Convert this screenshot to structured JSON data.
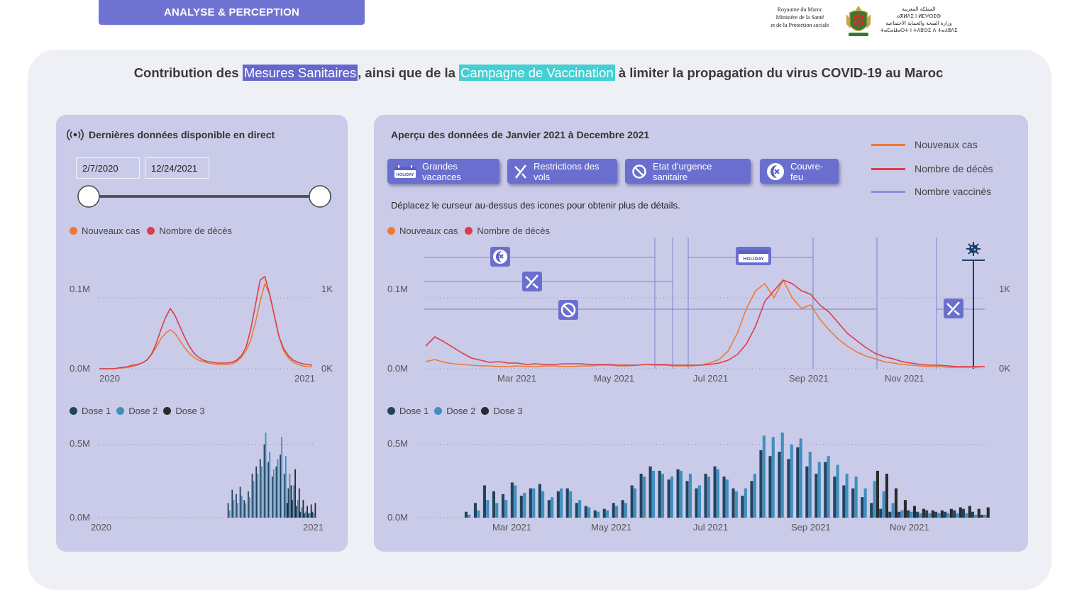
{
  "header": {
    "tab_label": "ANALYSE & PERCEPTION",
    "ministry_fr": [
      "Royaume du Maroc",
      "Ministère de la Santé",
      "et de la Protection sociale"
    ],
    "ministry_ar": [
      "المملكة المغربية",
      "ⴰⴳⵍⴷⵉ ⵏ ⵍⵎⵖⵔⵉⴱ",
      "وزارة الصحة والحماية الاجتماعية",
      "ⵜⴰⵎⴰⵡⴰⵙⵜ ⵏ ⵜⴷⵓⵙⵉ ⴷ ⵜⴰⵃⵓⴷⵉ"
    ],
    "emblem_icon": "coat-of-arms-icon"
  },
  "headline": {
    "before": "Contribution des ",
    "highlight1": "Mesures Sanitaires",
    "middle": ", ainsi que de la ",
    "highlight2": "Campagne de Vaccination",
    "after": " à limiter la propagation du virus COVID-19 au Maroc"
  },
  "left_panel": {
    "title": "Dernières données disponible en direct",
    "live_icon": "broadcast-icon",
    "date_start": "2/7/2020",
    "date_end": "12/24/2021",
    "slider_start": 0,
    "slider_end": 1
  },
  "right_panel": {
    "title": "Aperçu des données de Janvier 2021 à Decembre 2021",
    "buttons": [
      {
        "label": "Grandes vacances",
        "icon": "holiday-icon"
      },
      {
        "label": "Restrictions des vols",
        "icon": "plane-off-icon"
      },
      {
        "label": "Etat d'urgence sanitaire",
        "icon": "prohibited-icon"
      },
      {
        "label": "Couvre-feu",
        "icon": "curfew-icon"
      }
    ],
    "hint": "Déplacez le curseur au-dessus des icones pour obtenir plus de détails.",
    "legend": [
      {
        "label": "Nouveaux cas",
        "color": "#ee7a30"
      },
      {
        "label": "Nombre de décès",
        "color": "#dd3c4a"
      },
      {
        "label": "Nombre vaccinés",
        "color": "#8a8fd8"
      }
    ]
  },
  "colors": {
    "accent": "#6f74d3",
    "cases": "#ee7a30",
    "deaths": "#dd3c4a",
    "dose1": "#20445f",
    "dose2": "#3f8fbf",
    "dose3": "#2b2b2b"
  },
  "chart_data": [
    {
      "id": "left-cases",
      "type": "line",
      "legend": [
        "Nouveaux cas",
        "Nombre de décès"
      ],
      "x_ticks": [
        "2020",
        "2021"
      ],
      "y_left_ticks": [
        "0.0M",
        "0.1M"
      ],
      "y_right_ticks": [
        "0K",
        "1K"
      ],
      "ylim_left": [
        0,
        0.15
      ],
      "ylim_right": [
        0,
        1.5
      ],
      "series": [
        {
          "name": "Nouveaux cas",
          "axis": "left",
          "values": [
            0,
            0,
            0,
            0,
            0.001,
            0.001,
            0.002,
            0.003,
            0.005,
            0.008,
            0.012,
            0.02,
            0.03,
            0.042,
            0.05,
            0.055,
            0.05,
            0.04,
            0.03,
            0.022,
            0.016,
            0.012,
            0.01,
            0.008,
            0.007,
            0.006,
            0.006,
            0.006,
            0.007,
            0.01,
            0.016,
            0.025,
            0.04,
            0.065,
            0.095,
            0.12,
            0.105,
            0.075,
            0.045,
            0.025,
            0.015,
            0.009,
            0.006,
            0.004,
            0.003,
            0.003
          ]
        },
        {
          "name": "Nombre de décès",
          "axis": "right",
          "values": [
            0,
            0,
            0,
            0,
            0.01,
            0.02,
            0.03,
            0.05,
            0.06,
            0.08,
            0.12,
            0.2,
            0.35,
            0.55,
            0.72,
            0.85,
            0.75,
            0.6,
            0.45,
            0.32,
            0.22,
            0.16,
            0.12,
            0.1,
            0.09,
            0.08,
            0.08,
            0.08,
            0.09,
            0.12,
            0.18,
            0.3,
            0.55,
            0.9,
            1.25,
            1.3,
            1.05,
            0.75,
            0.45,
            0.28,
            0.18,
            0.12,
            0.09,
            0.07,
            0.06,
            0.05
          ]
        }
      ]
    },
    {
      "id": "left-doses",
      "type": "bar",
      "legend": [
        "Dose 1",
        "Dose 2",
        "Dose 3"
      ],
      "x_ticks": [
        "2020",
        "2021"
      ],
      "y_ticks": [
        "0.0M",
        "0.5M"
      ],
      "ylim": [
        0,
        0.6
      ],
      "series": [
        {
          "name": "Dose 1",
          "values": [
            0,
            0,
            0,
            0,
            0,
            0,
            0,
            0,
            0,
            0,
            0,
            0,
            0,
            0,
            0,
            0,
            0,
            0,
            0,
            0,
            0,
            0,
            0,
            0,
            0,
            0,
            0,
            0,
            0,
            0,
            0,
            0,
            0.1,
            0.19,
            0.16,
            0.21,
            0.12,
            0.18,
            0.3,
            0.35,
            0.4,
            0.5,
            0.38,
            0.28,
            0.35,
            0.43,
            0.3,
            0.2,
            0.12,
            0.08,
            0.04,
            0.03,
            0.03,
            0.04
          ]
        },
        {
          "name": "Dose 2",
          "values": [
            0,
            0,
            0,
            0,
            0,
            0,
            0,
            0,
            0,
            0,
            0,
            0,
            0,
            0,
            0,
            0,
            0,
            0,
            0,
            0,
            0,
            0,
            0,
            0,
            0,
            0,
            0,
            0,
            0,
            0,
            0,
            0,
            0.05,
            0.12,
            0.1,
            0.15,
            0.1,
            0.14,
            0.25,
            0.3,
            0.35,
            0.58,
            0.45,
            0.33,
            0.4,
            0.55,
            0.42,
            0.3,
            0.22,
            0.12,
            0.07,
            0.04,
            0.03,
            0.03
          ]
        },
        {
          "name": "Dose 3",
          "values": [
            0,
            0,
            0,
            0,
            0,
            0,
            0,
            0,
            0,
            0,
            0,
            0,
            0,
            0,
            0,
            0,
            0,
            0,
            0,
            0,
            0,
            0,
            0,
            0,
            0,
            0,
            0,
            0,
            0,
            0,
            0,
            0,
            0,
            0,
            0,
            0,
            0,
            0,
            0,
            0,
            0,
            0,
            0,
            0,
            0,
            0,
            0.1,
            0.22,
            0.33,
            0.2,
            0.12,
            0.08,
            0.09,
            0.1
          ]
        }
      ]
    },
    {
      "id": "right-cases",
      "type": "line",
      "legend": [
        "Nouveaux cas",
        "Nombre de décès"
      ],
      "x_ticks": [
        "Mar 2021",
        "May 2021",
        "Jul 2021",
        "Sep 2021",
        "Nov 2021"
      ],
      "y_left_ticks": [
        "0.0M",
        "0.1M"
      ],
      "y_right_ticks": [
        "0K",
        "1K"
      ],
      "ylim_left": [
        0,
        0.15
      ],
      "ylim_right": [
        0,
        1.5
      ],
      "series": [
        {
          "name": "Nouveaux cas",
          "axis": "left",
          "values": [
            0.01,
            0.013,
            0.009,
            0.007,
            0.006,
            0.005,
            0.004,
            0.004,
            0.003,
            0.003,
            0.004,
            0.003,
            0.003,
            0.004,
            0.004,
            0.003,
            0.003,
            0.004,
            0.004,
            0.005,
            0.005,
            0.004,
            0.004,
            0.005,
            0.006,
            0.005,
            0.005,
            0.004,
            0.004,
            0.004,
            0.005,
            0.008,
            0.013,
            0.025,
            0.05,
            0.085,
            0.11,
            0.12,
            0.1,
            0.125,
            0.1,
            0.085,
            0.09,
            0.07,
            0.055,
            0.042,
            0.032,
            0.024,
            0.018,
            0.014,
            0.01,
            0.008,
            0.006,
            0.005,
            0.004,
            0.003,
            0.003,
            0.002,
            0.002,
            0.002,
            0.002,
            0.003
          ]
        },
        {
          "name": "Nombre de décès",
          "axis": "right",
          "values": [
            0.32,
            0.45,
            0.38,
            0.3,
            0.22,
            0.15,
            0.12,
            0.09,
            0.1,
            0.08,
            0.08,
            0.06,
            0.07,
            0.06,
            0.06,
            0.07,
            0.07,
            0.07,
            0.06,
            0.06,
            0.06,
            0.05,
            0.05,
            0.05,
            0.06,
            0.06,
            0.06,
            0.05,
            0.05,
            0.05,
            0.05,
            0.06,
            0.08,
            0.12,
            0.2,
            0.35,
            0.6,
            0.95,
            1.1,
            1.25,
            1.2,
            1.1,
            1.05,
            0.9,
            0.8,
            0.65,
            0.5,
            0.4,
            0.3,
            0.22,
            0.17,
            0.14,
            0.1,
            0.08,
            0.06,
            0.05,
            0.05,
            0.04,
            0.03,
            0.03,
            0.03,
            0.03
          ]
        }
      ]
    },
    {
      "id": "right-doses",
      "type": "bar",
      "legend": [
        "Dose 1",
        "Dose 2",
        "Dose 3"
      ],
      "x_ticks": [
        "Mar 2021",
        "May 2021",
        "Jul 2021",
        "Sep 2021",
        "Nov 2021"
      ],
      "y_ticks": [
        "0.0M",
        "0.5M"
      ],
      "ylim": [
        0,
        0.6
      ],
      "series": [
        {
          "name": "Dose 1",
          "values": [
            0,
            0,
            0,
            0,
            0,
            0.04,
            0.1,
            0.22,
            0.18,
            0.16,
            0.24,
            0.15,
            0.2,
            0.23,
            0.12,
            0.18,
            0.2,
            0.1,
            0.08,
            0.05,
            0.06,
            0.1,
            0.12,
            0.22,
            0.3,
            0.35,
            0.32,
            0.26,
            0.33,
            0.25,
            0.2,
            0.3,
            0.35,
            0.28,
            0.2,
            0.15,
            0.25,
            0.46,
            0.42,
            0.45,
            0.4,
            0.48,
            0.35,
            0.3,
            0.38,
            0.28,
            0.22,
            0.2,
            0.14,
            0.1,
            0.06,
            0.04,
            0.04,
            0.05,
            0.04,
            0.05,
            0.04,
            0.04,
            0.05,
            0.06,
            0.04,
            0.02
          ]
        },
        {
          "name": "Dose 2",
          "values": [
            0,
            0,
            0,
            0,
            0,
            0.02,
            0.05,
            0.12,
            0.1,
            0.12,
            0.22,
            0.17,
            0.2,
            0.18,
            0.14,
            0.2,
            0.18,
            0.12,
            0.07,
            0.04,
            0.05,
            0.08,
            0.1,
            0.2,
            0.28,
            0.32,
            0.3,
            0.28,
            0.32,
            0.3,
            0.22,
            0.28,
            0.33,
            0.26,
            0.18,
            0.2,
            0.3,
            0.56,
            0.55,
            0.58,
            0.5,
            0.54,
            0.45,
            0.38,
            0.42,
            0.36,
            0.3,
            0.28,
            0.2,
            0.25,
            0.18,
            0.1,
            0.05,
            0.04,
            0.03,
            0.03,
            0.03,
            0.03,
            0.03,
            0.03,
            0.02,
            0.02
          ]
        },
        {
          "name": "Dose 3",
          "values": [
            0,
            0,
            0,
            0,
            0,
            0,
            0,
            0,
            0,
            0,
            0,
            0,
            0,
            0,
            0,
            0,
            0,
            0,
            0,
            0,
            0,
            0,
            0,
            0,
            0,
            0,
            0,
            0,
            0,
            0,
            0,
            0,
            0,
            0,
            0,
            0,
            0,
            0,
            0,
            0,
            0,
            0,
            0,
            0,
            0,
            0,
            0,
            0,
            0,
            0.32,
            0.3,
            0.2,
            0.12,
            0.08,
            0.06,
            0.05,
            0.05,
            0.06,
            0.07,
            0.08,
            0.06,
            0.07
          ]
        }
      ]
    }
  ]
}
